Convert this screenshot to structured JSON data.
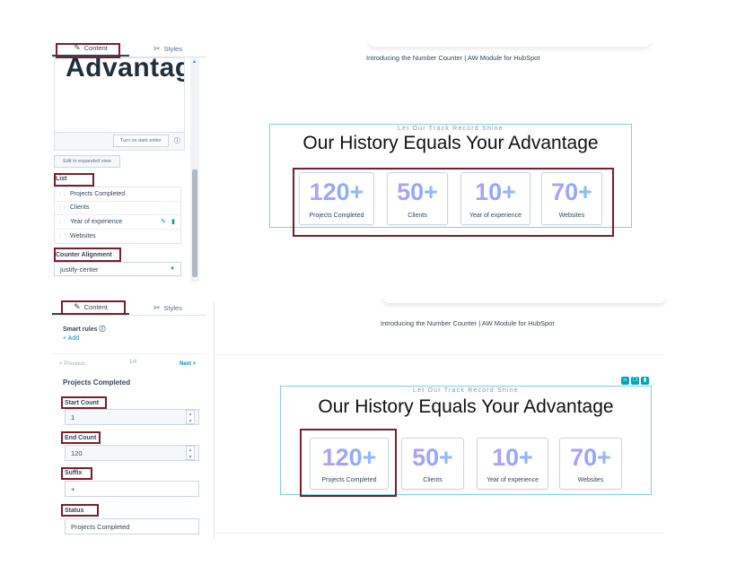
{
  "panel_tabs": {
    "content": "Content",
    "styles": "Styles"
  },
  "top_panel": {
    "editor_preview_text": "Advantage",
    "dark_editor_button": "Turn on dark editor",
    "expanded_view_button": "Edit in expanded view",
    "list_label": "List",
    "list_items": [
      "Projects Completed",
      "Clients",
      "Year of experience",
      "Websites"
    ],
    "counter_alignment_label": "Counter Alignment",
    "counter_alignment_value": "justify-center"
  },
  "bottom_panel": {
    "smart_rules_label": "Smart rules",
    "add_link": "+ Add",
    "previous_link": "< Previous",
    "pager": "1/4",
    "next_link": "Next >",
    "item_title": "Projects Completed",
    "start_count_label": "Start Count",
    "start_count_value": "1",
    "end_count_label": "End Count",
    "end_count_value": "120",
    "suffix_label": "Suffix",
    "suffix_value": "+",
    "status_label": "Status",
    "status_value": "Projects Completed"
  },
  "preview": {
    "intro_text": "Introducing the Number Counter | AW Module for HubSpot",
    "kicker": "Let Our Track Record Shine",
    "headline": "Our History Equals Your Advantage",
    "counters": [
      {
        "number": "120+",
        "label": "Projects Completed"
      },
      {
        "number": "50+",
        "label": "Clients"
      },
      {
        "number": "10+",
        "label": "Year of experience"
      },
      {
        "number": "70+",
        "label": "Websites"
      }
    ]
  },
  "colors": {
    "highlight": "#7a1e2a",
    "module_border": "#7fd1de",
    "accent": "#00a4bd"
  }
}
